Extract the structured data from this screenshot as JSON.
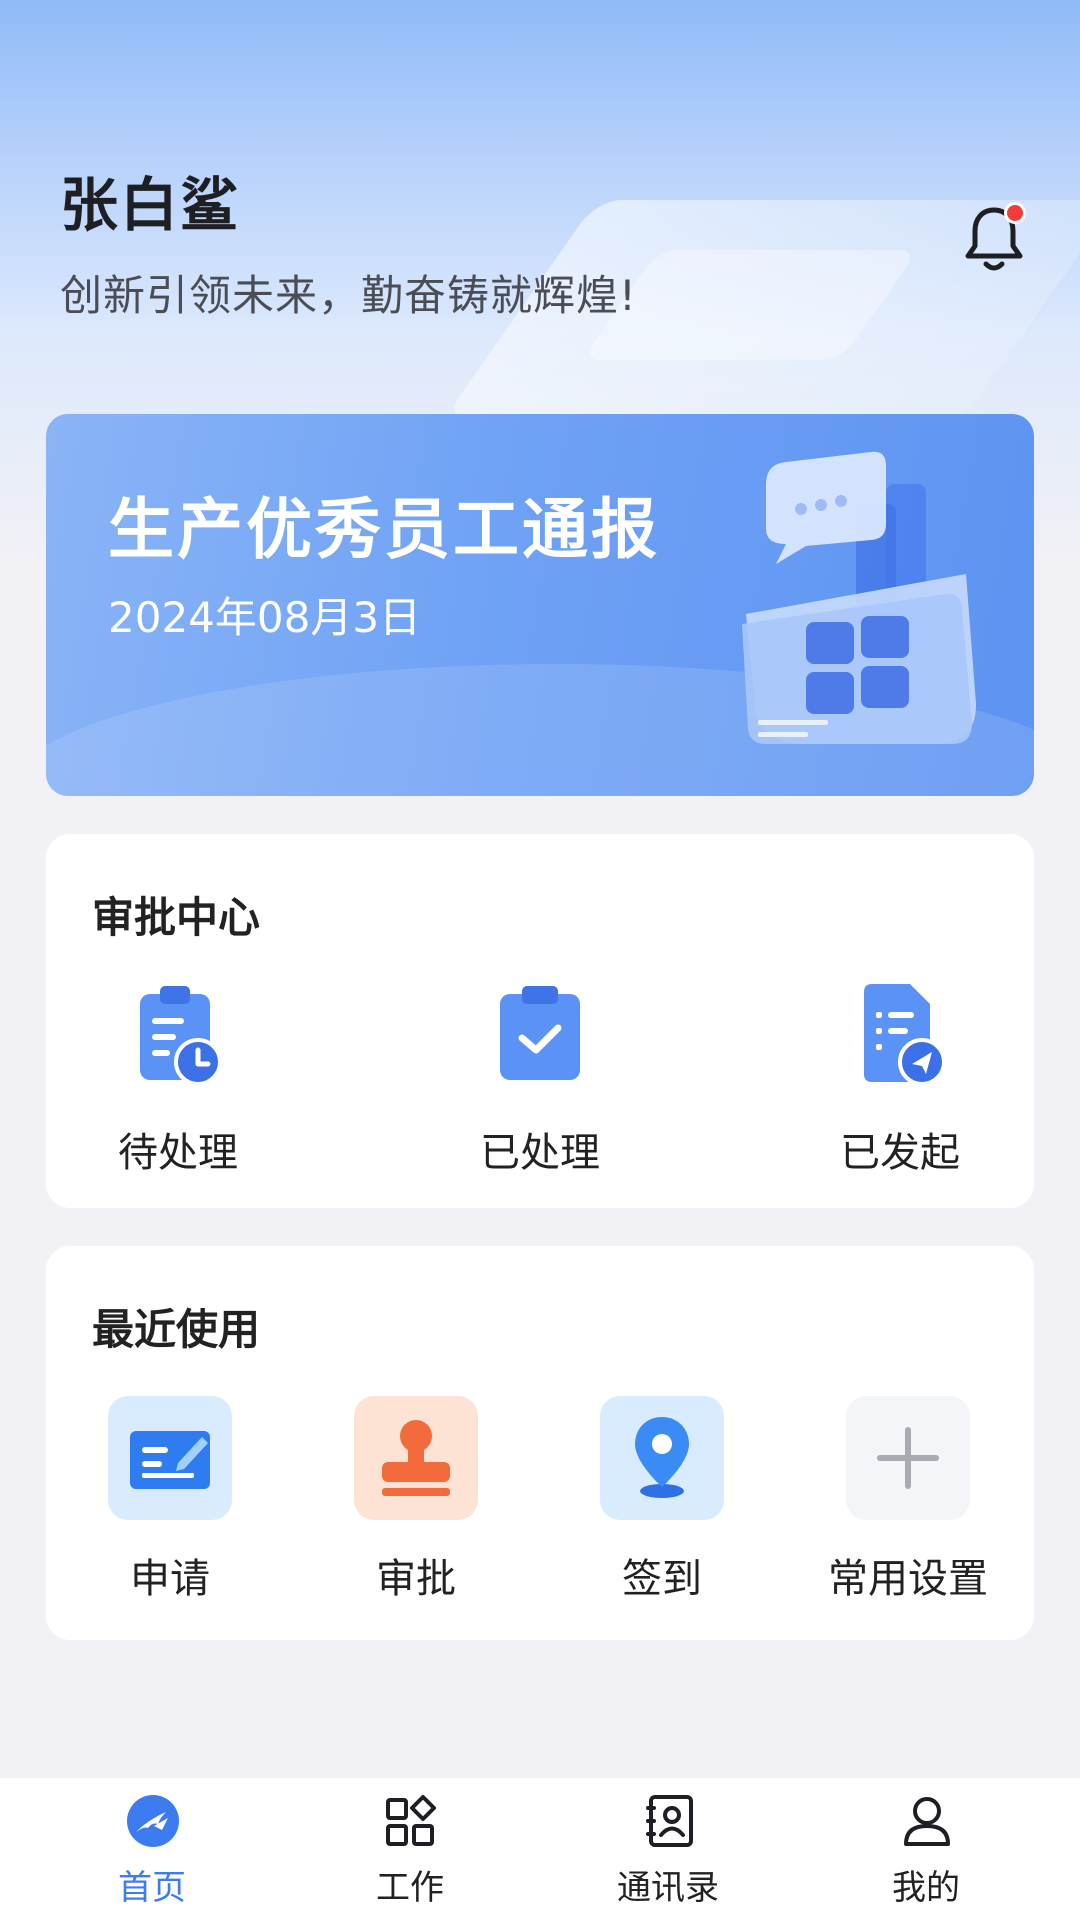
{
  "header": {
    "user_name": "张白鲨",
    "slogan": "创新引领未来，勤奋铸就辉煌!",
    "bell_icon": "bell-icon",
    "has_notification": true
  },
  "banner": {
    "title": "生产优秀员工通报",
    "date": "2024年08月3日"
  },
  "approval_center": {
    "title": "审批中心",
    "items": [
      {
        "label": "待处理",
        "icon": "clipboard-clock-icon"
      },
      {
        "label": "已处理",
        "icon": "clipboard-check-icon"
      },
      {
        "label": "已发起",
        "icon": "document-send-icon"
      }
    ]
  },
  "recent": {
    "title": "最近使用",
    "items": [
      {
        "label": "申请",
        "icon": "form-edit-icon"
      },
      {
        "label": "审批",
        "icon": "stamp-icon"
      },
      {
        "label": "签到",
        "icon": "location-pin-icon"
      },
      {
        "label": "常用设置",
        "icon": "plus-icon"
      }
    ]
  },
  "tabbar": {
    "items": [
      {
        "label": "首页",
        "icon": "home-logo-icon",
        "active": true
      },
      {
        "label": "工作",
        "icon": "apps-grid-icon",
        "active": false
      },
      {
        "label": "通讯录",
        "icon": "contacts-book-icon",
        "active": false
      },
      {
        "label": "我的",
        "icon": "person-icon",
        "active": false
      }
    ]
  },
  "colors": {
    "accent": "#3c7cf0",
    "badge": "#f23b3b",
    "stamp_bg": "#fde3d3",
    "blue_tile_bg": "#d9ecff"
  }
}
